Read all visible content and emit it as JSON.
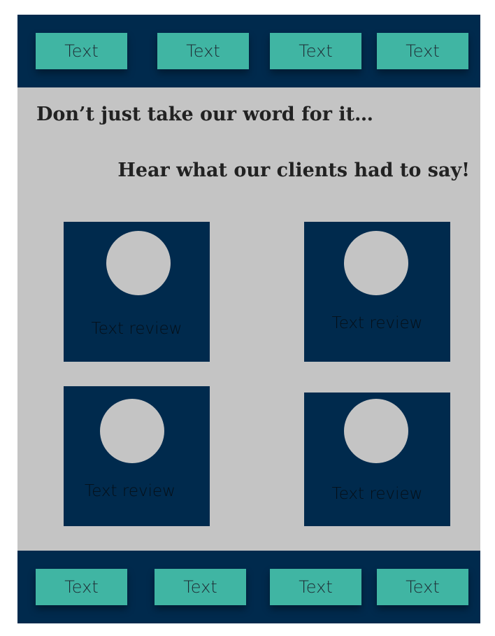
{
  "header": {
    "nav": [
      {
        "label": "Text"
      },
      {
        "label": "Text"
      },
      {
        "label": "Text"
      },
      {
        "label": "Text"
      }
    ]
  },
  "main": {
    "heading": "Don’t just take our word for it…",
    "subheading": "Hear what our clients had to say!",
    "reviews": [
      {
        "text": "Text review"
      },
      {
        "text": "Text review"
      },
      {
        "text": "Text review"
      },
      {
        "text": "Text review"
      }
    ]
  },
  "footer": {
    "nav": [
      {
        "label": "Text"
      },
      {
        "label": "Text"
      },
      {
        "label": "Text"
      },
      {
        "label": "Text"
      }
    ]
  },
  "colors": {
    "navy": "#002a4d",
    "teal": "#40b5a3",
    "gray": "#c4c4c4"
  }
}
